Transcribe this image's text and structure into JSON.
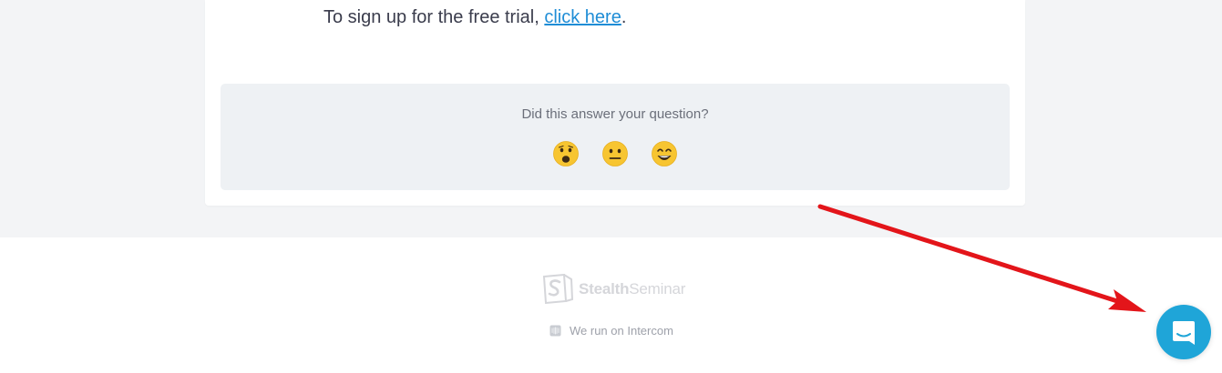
{
  "article": {
    "signup_prefix": "To sign up for the free trial, ",
    "signup_link": "click here",
    "signup_suffix": "."
  },
  "feedback": {
    "question": "Did this answer your question?",
    "reactions": [
      {
        "icon": "disappointed-face-icon"
      },
      {
        "icon": "neutral-face-icon"
      },
      {
        "icon": "smiley-face-icon"
      }
    ]
  },
  "footer": {
    "logo_bold": "Stealth",
    "logo_light": "Seminar",
    "intercom_note": "We run on Intercom"
  },
  "colors": {
    "link": "#1f8dd6",
    "launcher": "#1fa5d8",
    "annotation_arrow": "#e3151a",
    "emoji": "#f7c531"
  },
  "messenger": {
    "icon": "chat-bubble-icon"
  }
}
